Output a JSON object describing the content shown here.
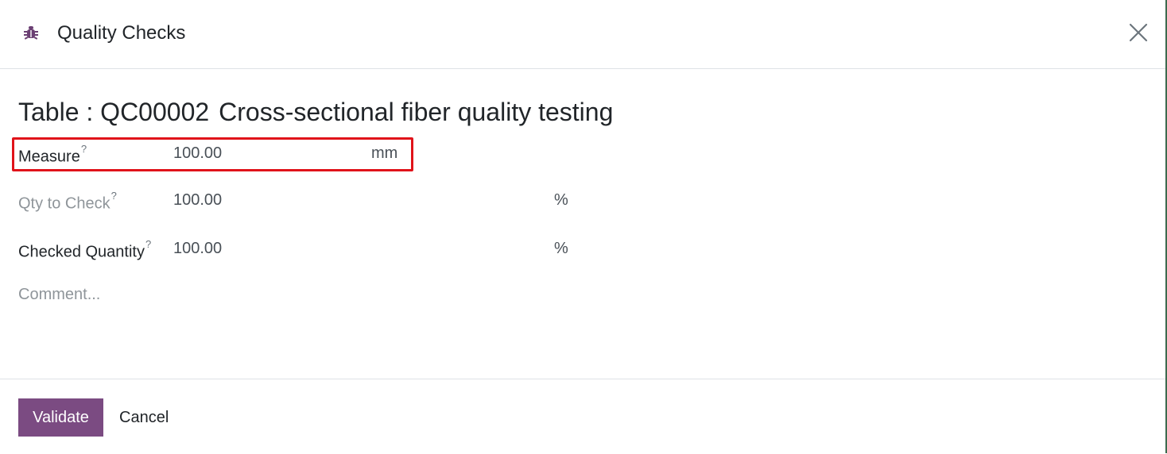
{
  "dialog": {
    "title": "Quality Checks",
    "app_icon": "bug-icon",
    "close_icon": "close-icon",
    "accent_color": "#7b4b82",
    "highlight_color": "#e0131a"
  },
  "record": {
    "product": "Table :",
    "reference": "QC00002",
    "name": "Cross-sectional fiber quality testing"
  },
  "fields": {
    "measure": {
      "label": "Measure",
      "help": "?",
      "value": "100.00",
      "unit": "mm"
    },
    "qty_to_check": {
      "label": "Qty to Check",
      "help": "?",
      "value": "100.00",
      "unit": "%"
    },
    "checked_quantity": {
      "label": "Checked Quantity",
      "help": "?",
      "value": "100.00",
      "unit": "%"
    },
    "comment": {
      "placeholder": "Comment..."
    }
  },
  "footer": {
    "validate_label": "Validate",
    "cancel_label": "Cancel"
  }
}
